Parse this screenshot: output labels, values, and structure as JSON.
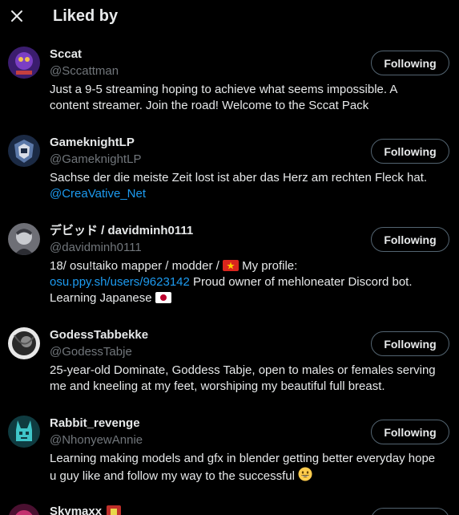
{
  "header": {
    "title": "Liked by"
  },
  "users": [
    {
      "name": "Sccat",
      "handle": "@Sccattman",
      "button": "Following",
      "bio": {
        "line1": "Just a 9-5 streaming hoping to achieve what seems impossible. A",
        "line2": "content streamer. Join the road! Welcome to the Sccat Pack"
      }
    },
    {
      "name": "GameknightLP",
      "handle": "@GameknightLP",
      "button": "Following",
      "bio": {
        "line1": "Sachse der die meiste Zeit lost ist aber das Herz am rechten Fleck hat.",
        "link": "@CreaVative_Net"
      }
    },
    {
      "name": "デビッド / davidminh0111",
      "handle": "@davidminh0111",
      "button": "Following",
      "bio": {
        "line1_pre": "18/ osu!taiko mapper / modder / ",
        "line1_post": " My profile:",
        "link": "osu.ppy.sh/users/9623142",
        "line2_post": " Proud owner of mehloneater Discord bot.",
        "line3": "Learning Japanese "
      }
    },
    {
      "name": "GodessTabbekke",
      "handle": "@GodessTabje",
      "button": "Following",
      "bio": {
        "line1": "25-year-old Dominate, Goddess Tabje, open to males or females serving",
        "line2": "me and kneeling at my feet, worshiping my beautiful full breast."
      }
    },
    {
      "name": "Rabbit_revenge",
      "handle": "@NhonyewAnnie",
      "button": "Following",
      "bio": {
        "line1": "Learning making models and gfx in blender getting better everyday hope",
        "line2": "u guy like and follow my way to the successful "
      }
    },
    {
      "name": "Skymaxx",
      "button": "Following"
    }
  ],
  "colors": {
    "accent": "#1d9bf0",
    "muted": "#71767b",
    "text": "#e7e9ea",
    "border": "#536471"
  }
}
